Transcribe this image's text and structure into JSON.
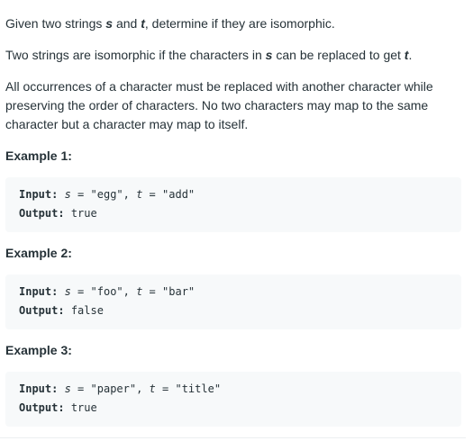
{
  "description": {
    "intro": {
      "before": "Given two strings ",
      "var_s": "s",
      "middle": " and ",
      "var_t": "t",
      "after": ", determine if they are isomorphic."
    },
    "definition": {
      "before": "Two strings are isomorphic if the characters in ",
      "var_s": "s",
      "middle": " can be replaced to get ",
      "var_t": "t",
      "after": "."
    },
    "rules_lines": [
      "All occurrences of a character must be replaced with another character while",
      "preserving the order of characters. No two characters may map to the same",
      "character but a character may map to itself."
    ]
  },
  "examples": [
    {
      "title": "Example 1:",
      "input_label": "Input:",
      "var_s": "s",
      "s_value": "\"egg\"",
      "var_t": "t",
      "t_value": "\"add\"",
      "output_label": "Output:",
      "output_value": "true"
    },
    {
      "title": "Example 2:",
      "input_label": "Input:",
      "var_s": "s",
      "s_value": "\"foo\"",
      "var_t": "t",
      "t_value": "\"bar\"",
      "output_label": "Output:",
      "output_value": "false"
    },
    {
      "title": "Example 3:",
      "input_label": "Input:",
      "var_s": "s",
      "s_value": "\"paper\"",
      "var_t": "t",
      "t_value": "\"title\"",
      "output_label": "Output:",
      "output_value": "true"
    }
  ]
}
